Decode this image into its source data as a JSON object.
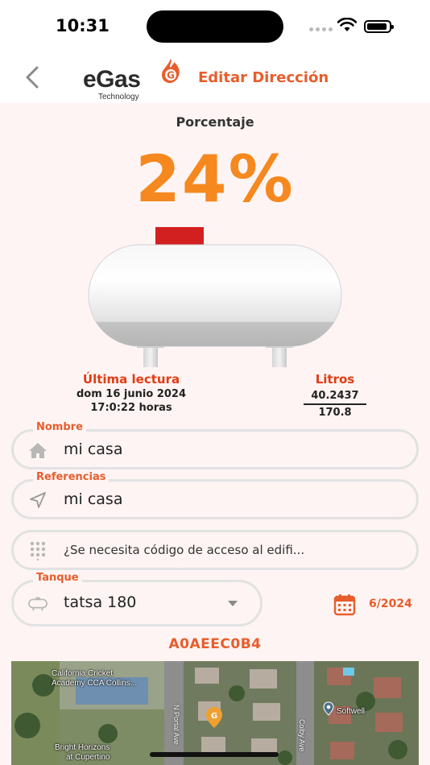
{
  "status_bar": {
    "time": "10:31"
  },
  "header": {
    "logo_text": "eGas",
    "logo_badge": "G",
    "logo_subtitle": "Technology",
    "title": "Editar Dirección"
  },
  "gauge": {
    "label": "Porcentaje",
    "percent_text": "24%",
    "level": 0.24
  },
  "reading": {
    "title": "Última lectura",
    "date": "dom 16 junio 2024",
    "time": "17:0:22 horas"
  },
  "liters": {
    "title": "Litros",
    "current": "40.2437",
    "capacity": "170.8"
  },
  "form": {
    "name": {
      "legend": "Nombre",
      "value": "mi casa",
      "icon": "home-icon"
    },
    "references": {
      "legend": "Referencias",
      "value": "mi casa",
      "icon": "navigation-icon"
    },
    "access_code": {
      "placeholder": "¿Se necesita código de acceso al edifi...",
      "icon": "keypad-icon"
    },
    "tank": {
      "legend": "Tanque",
      "value": "tatsa 180",
      "icon": "tank-icon"
    },
    "date": "6/2024"
  },
  "tank_code": "A0AEEC0B4",
  "map": {
    "labels": [
      "California Cricket",
      "Academy CCA Collins...",
      "Bright Horizons",
      "at Cupertino",
      "Softwell"
    ],
    "streets": [
      "N Portal Ave",
      "Colby Ave"
    ],
    "marker_badge": "G"
  },
  "colors": {
    "accent": "#e85d2c",
    "percent": "#f5891f",
    "label_red": "#e23c14"
  }
}
